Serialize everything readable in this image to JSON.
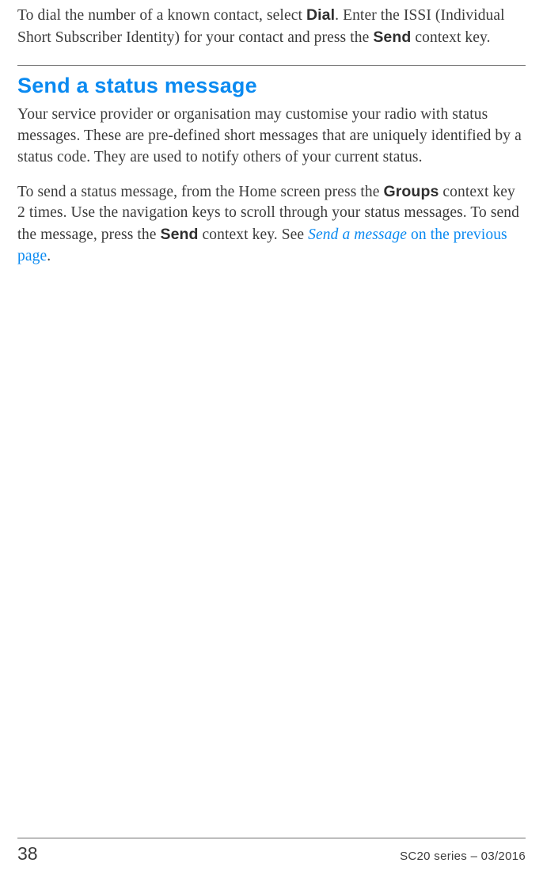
{
  "intro": {
    "t1": "To dial the number of a known contact, select ",
    "b1": "Dial",
    "t2": ". Enter the ISSI (Individual Short Subscriber Identity) for your contact and press the ",
    "b2": "Send",
    "t3": " context key."
  },
  "section": {
    "heading": "Send a status message",
    "p1": "Your service provider or organisation may customise your radio with status messages. These are pre-defined short messages that are uniquely identified by a status code. They are used to notify others of your current status.",
    "p2": {
      "t1": "To send a status message, from the Home screen press the ",
      "b1": "Groups",
      "t2": " context key 2 times. Use the navigation keys to scroll through your status messages. To send the message, press the ",
      "b2": "Send",
      "t3": " context key. See ",
      "link_italic": "Send a message",
      "link_roman": " on the previous page",
      "t4": "."
    }
  },
  "footer": {
    "page_number": "38",
    "doc_info": "SC20 series – 03/2016"
  }
}
